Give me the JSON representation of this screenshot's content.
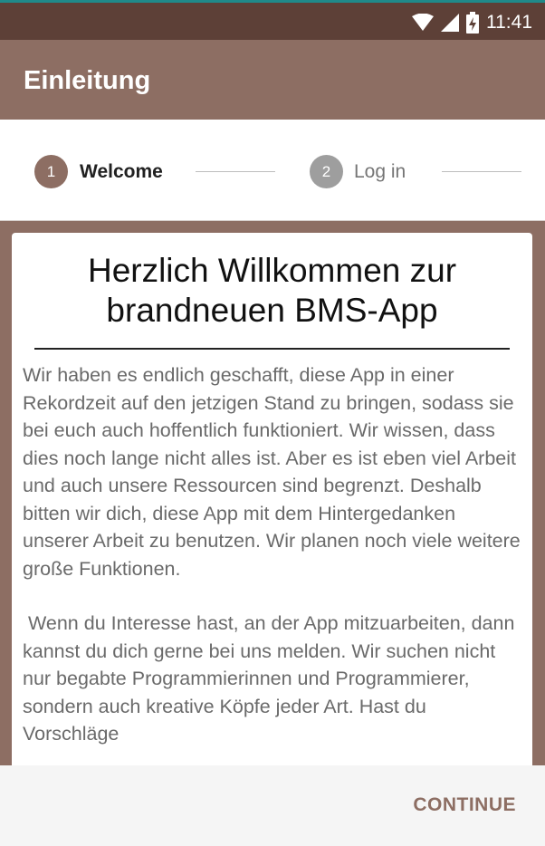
{
  "status_bar": {
    "time": "11:41",
    "icons": [
      "wifi-icon",
      "signal-icon",
      "battery-charging-icon"
    ]
  },
  "toolbar": {
    "title": "Einleitung"
  },
  "stepper": {
    "steps": [
      {
        "number": "1",
        "label": "Welcome",
        "state": "active"
      },
      {
        "number": "2",
        "label": "Log in",
        "state": "inactive"
      }
    ]
  },
  "card": {
    "title_line1": "Herzlich Willkommen zur",
    "title_line2": "brandneuen BMS-App",
    "paragraph1": "Wir haben es endlich geschafft, diese App in einer Rekordzeit auf den jetzigen Stand zu bringen, sodass sie bei euch auch hoffentlich funktioniert. Wir wissen, dass dies noch lange nicht alles ist. Aber es ist eben viel Arbeit und auch unsere Ressourcen sind begrenzt. Deshalb bitten wir dich, diese App mit dem Hintergedanken unserer Arbeit zu benutzen. Wir planen noch viele weitere große Funktionen.",
    "paragraph2": " Wenn du Interesse hast, an der App mitzuarbeiten, dann kannst du dich gerne bei uns melden. Wir suchen nicht nur begabte Programmierinnen und Programmierer, sondern auch kreative Köpfe jeder Art. Hast du Vorschläge"
  },
  "footer": {
    "continue_label": "CONTINUE"
  },
  "colors": {
    "primary": "#8d6e63",
    "primary_dark": "#5d4037",
    "inactive_step": "#9e9e9e"
  }
}
